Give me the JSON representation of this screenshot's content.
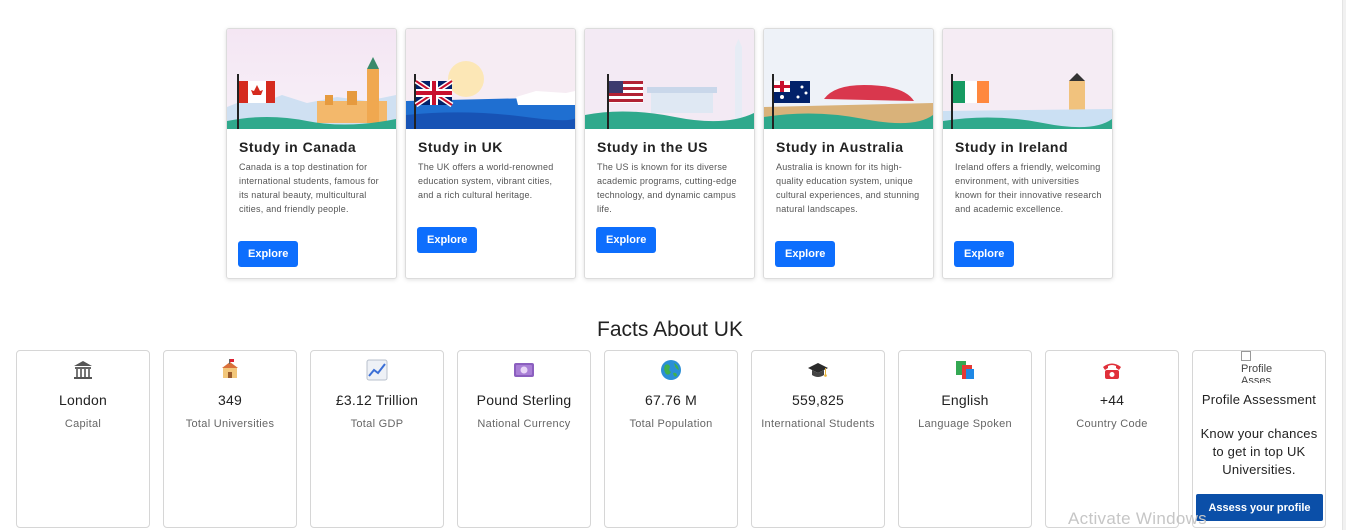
{
  "countries": [
    {
      "title": "Study in Canada",
      "desc": "Canada is a top destination for international students, famous for its natural beauty, multicultural cities, and friendly people.",
      "button": "Explore",
      "flag": "canada-flag"
    },
    {
      "title": "Study in UK",
      "desc": "The UK offers a world-renowned education system, vibrant cities, and a rich cultural heritage.",
      "button": "Explore",
      "flag": "uk-flag"
    },
    {
      "title": "Study in the US",
      "desc": "The US is known for its diverse academic programs, cutting-edge technology, and dynamic campus life.",
      "button": "Explore",
      "flag": "us-flag"
    },
    {
      "title": "Study in Australia",
      "desc": "Australia is known for its high-quality education system, unique cultural experiences, and stunning natural landscapes.",
      "button": "Explore",
      "flag": "australia-flag"
    },
    {
      "title": "Study in Ireland",
      "desc": "Ireland offers a friendly, welcoming environment, with universities known for their innovative research and academic excellence.",
      "button": "Explore",
      "flag": "ireland-flag"
    }
  ],
  "facts_title": "Facts About UK",
  "facts": [
    {
      "value": "London",
      "label": "Capital",
      "icon": "classical-building-icon"
    },
    {
      "value": "349",
      "label": "Total Universities",
      "icon": "school-icon"
    },
    {
      "value": "£3.12 Trillion",
      "label": "Total GDP",
      "icon": "chart-increasing-icon"
    },
    {
      "value": "Pound Sterling",
      "label": "National Currency",
      "icon": "pound-banknote-icon"
    },
    {
      "value": "67.76 M",
      "label": "Total Population",
      "icon": "globe-icon"
    },
    {
      "value": "559,825",
      "label": "International Students",
      "icon": "graduation-cap-icon"
    },
    {
      "value": "English",
      "label": "Language Spoken",
      "icon": "language-books-icon"
    },
    {
      "value": "+44",
      "label": "Country Code",
      "icon": "telephone-icon"
    }
  ],
  "assessment": {
    "img_alt": "Profile Asses",
    "title": "Profile Assessment",
    "text": "Know your chances to get in top UK Universities.",
    "button": "Assess your profile"
  },
  "watermark": "Activate Windows",
  "colors": {
    "primary": "#0d6efd",
    "assess_button": "#0b4fa8"
  }
}
